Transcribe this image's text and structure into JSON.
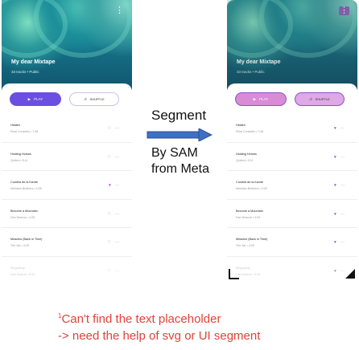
{
  "mixtape": {
    "title": "My dear Mixtape",
    "subtitle": "33 tracks • Public",
    "menu_icon": "more-vert-icon",
    "play_label": "PLAY",
    "shuffle_label": "SHUFFLE"
  },
  "tracks": [
    {
      "title": "Hidden",
      "meta": "Rival Consoles • 7:38"
    },
    {
      "title": "Holding Horses",
      "meta": "Qotiem • 5:11"
    },
    {
      "title": "Cumbia de la fuente",
      "meta": "Meridian Brothers • 4:35"
    },
    {
      "title": "Become a Mountain",
      "meta": "Dan Deacon • 4:05"
    },
    {
      "title": "Miracles (Back in Time)",
      "meta": "The Zar • 4:29"
    },
    {
      "title": "Singularity",
      "meta": "Dan Deacon • 6:29"
    }
  ],
  "annotation": {
    "segment": "Segment",
    "by_sam_line1": "By SAM",
    "by_sam_line2": "from Meta",
    "note_super": "1",
    "note_line1": "Can't find the text placeholder",
    "note_line2": "-> need the help of svg or UI segment"
  },
  "colors": {
    "play_button": "#6a4fe0",
    "segment_highlight": "#d88bd7",
    "segment_border": "#8a55c7",
    "arrow_fill": "#3f6fc4",
    "note_text": "#e0423a"
  }
}
